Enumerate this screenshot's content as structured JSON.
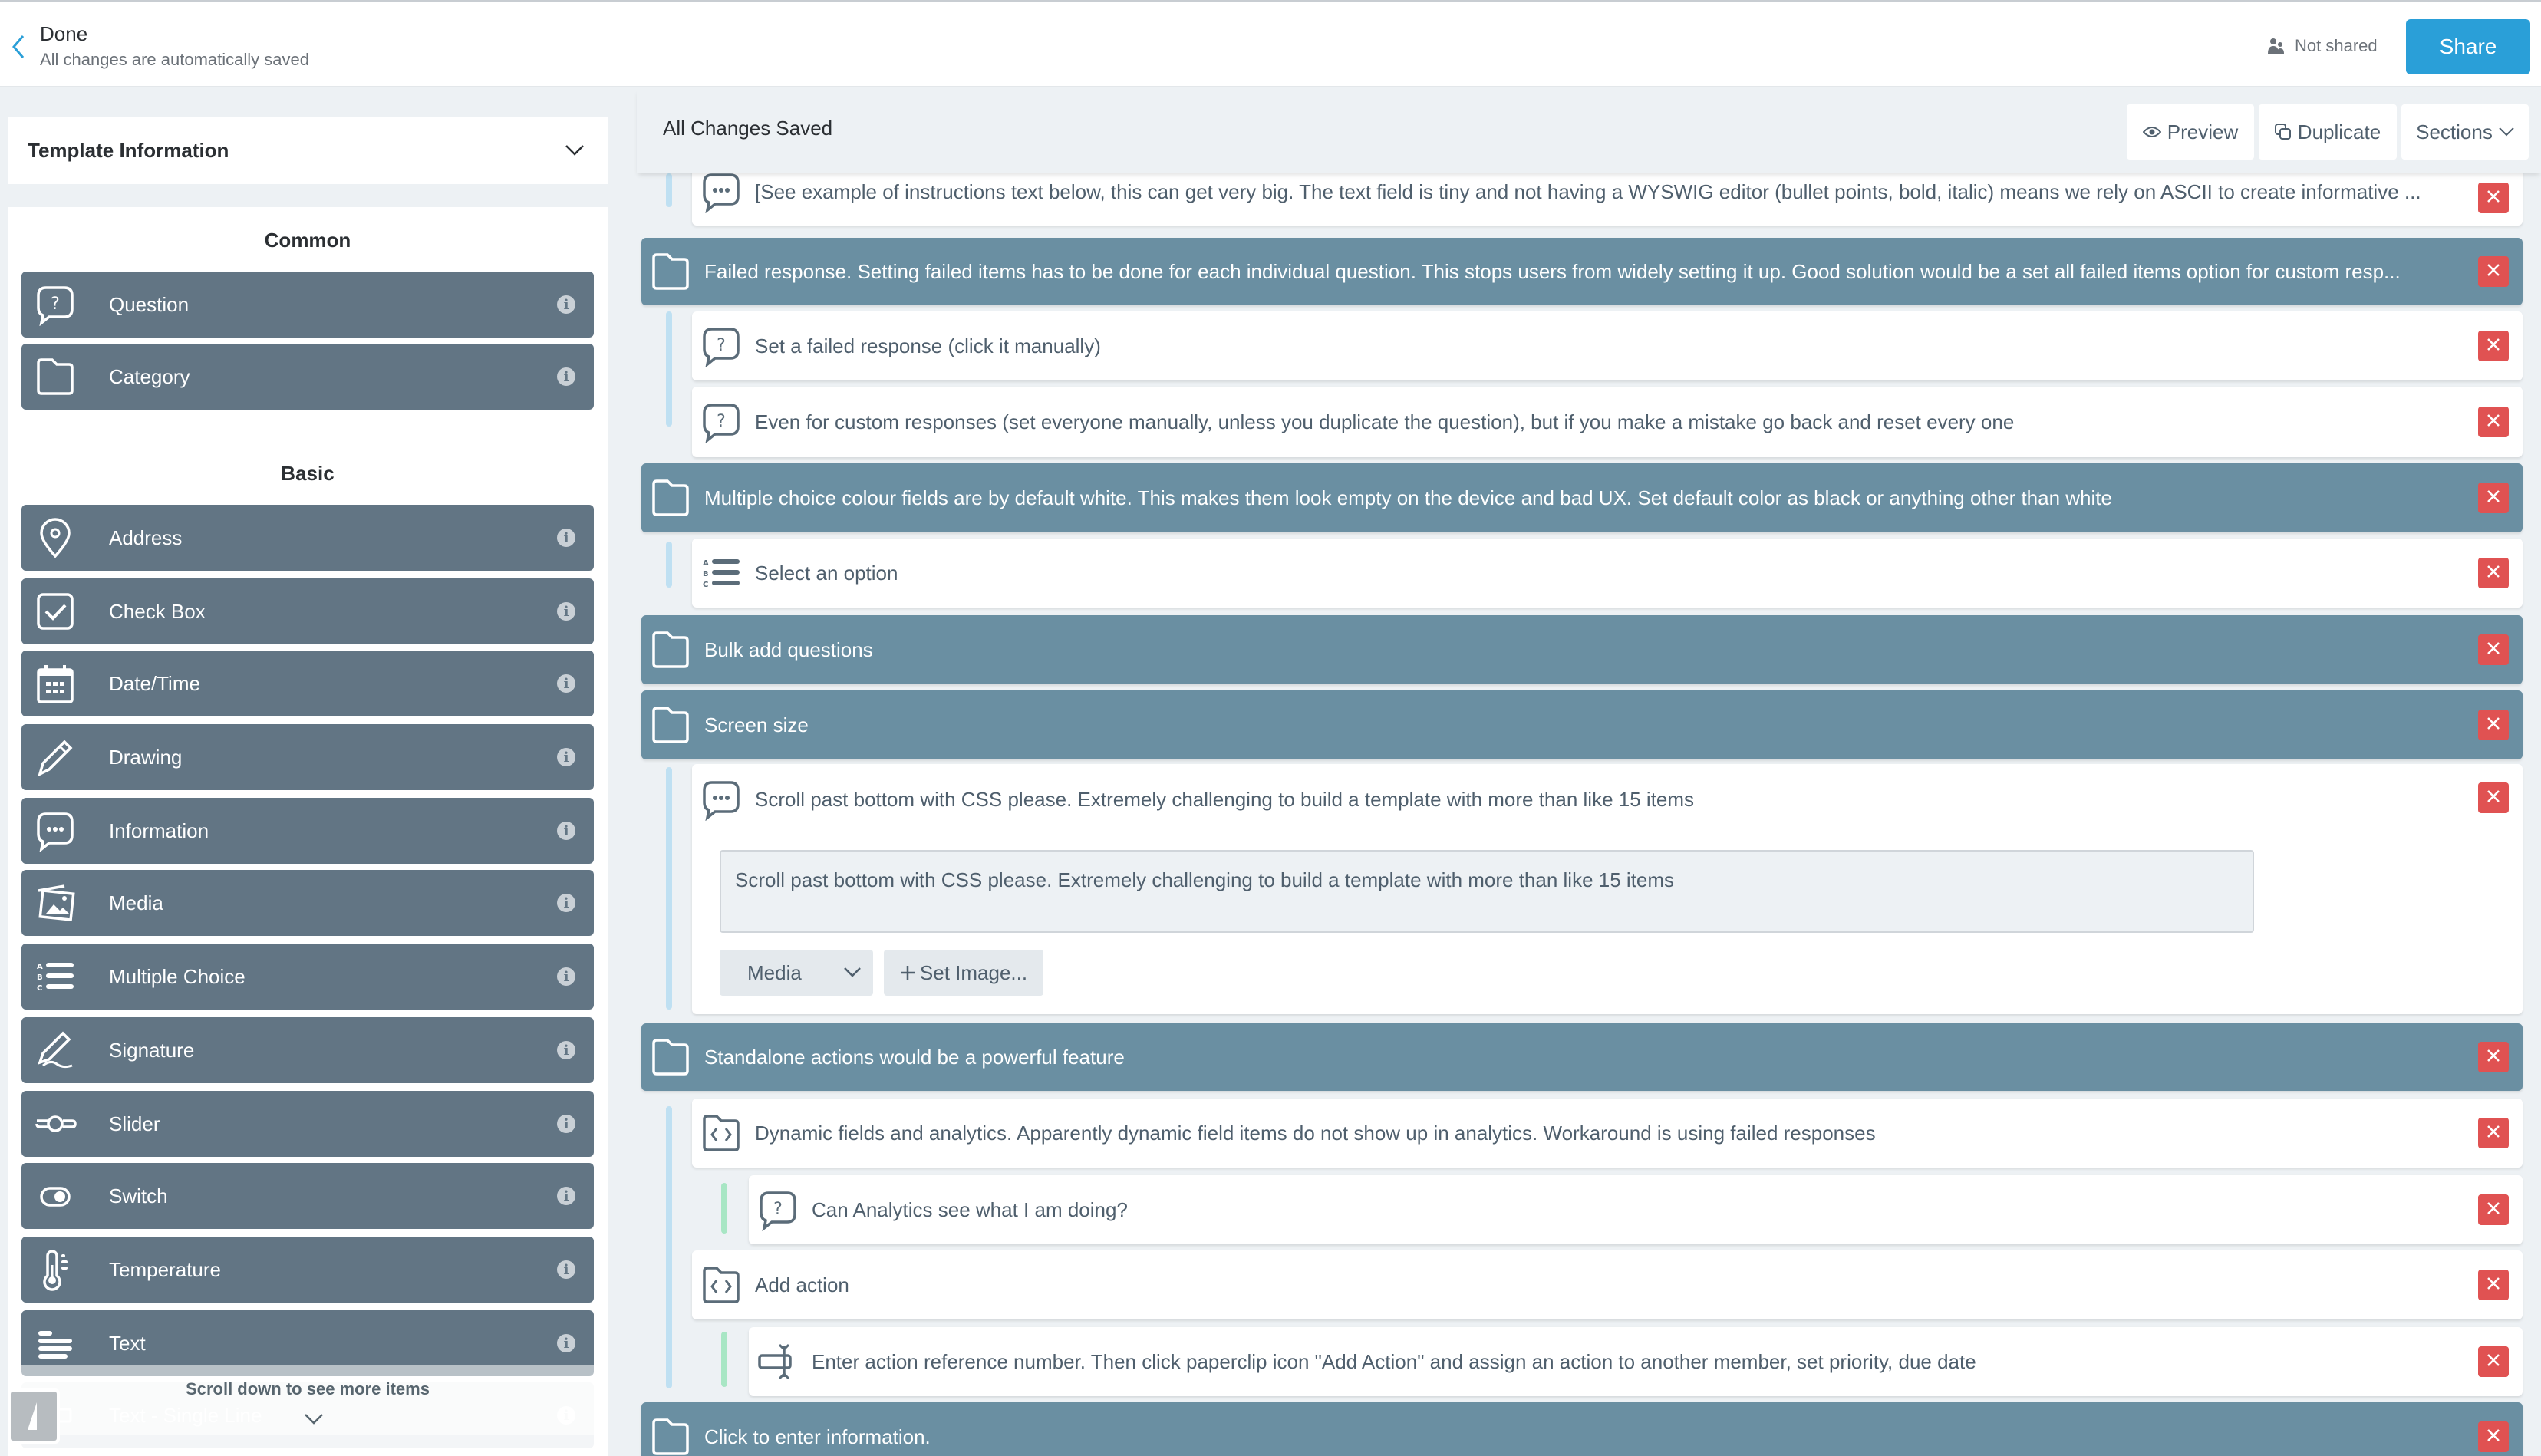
{
  "topbar": {
    "done_title": "Done",
    "done_subtitle": "All changes are automatically saved",
    "sharing_status": "Not shared",
    "share_label": "Share"
  },
  "sidebar": {
    "template_info_label": "Template Information",
    "groups": [
      {
        "title": "Common"
      },
      {
        "title": "Basic"
      }
    ],
    "items": [
      {
        "label": "Question",
        "icon": "question-bubble-icon"
      },
      {
        "label": "Category",
        "icon": "folder-icon"
      },
      {
        "label": "Address",
        "icon": "location-pin-icon"
      },
      {
        "label": "Check Box",
        "icon": "checkbox-icon"
      },
      {
        "label": "Date/Time",
        "icon": "calendar-icon"
      },
      {
        "label": "Drawing",
        "icon": "pencil-icon"
      },
      {
        "label": "Information",
        "icon": "info-bubble-icon"
      },
      {
        "label": "Media",
        "icon": "image-icon"
      },
      {
        "label": "Multiple Choice",
        "icon": "abc-list-icon"
      },
      {
        "label": "Signature",
        "icon": "signature-icon"
      },
      {
        "label": "Slider",
        "icon": "slider-icon"
      },
      {
        "label": "Switch",
        "icon": "switch-icon"
      },
      {
        "label": "Temperature",
        "icon": "thermometer-icon"
      },
      {
        "label": "Text",
        "icon": "text-lines-icon"
      },
      {
        "label": "Text - Single Line",
        "icon": "text-single-line-icon"
      }
    ],
    "info_glyph": "i",
    "scroll_hint": "Scroll down to see more items"
  },
  "main": {
    "saved_status": "All Changes Saved",
    "preview_label": "Preview",
    "duplicate_label": "Duplicate",
    "sections_label": "Sections",
    "rows": [
      {
        "type": "item",
        "icon": "info-bubble-icon",
        "text": "[See example of instructions text below, this can get very big. The text field is tiny and not having a WYSWIG editor (bullet points, bold, italic) means we rely on ASCII to create informative ..."
      },
      {
        "type": "category",
        "icon": "folder-icon",
        "text": "Failed response. Setting failed items has to be done for each individual question. This stops users from widely setting it up. Good solution would be a set all failed items option for custom resp..."
      },
      {
        "type": "item",
        "icon": "question-bubble-icon",
        "text": "Set a failed response (click it manually)"
      },
      {
        "type": "item",
        "icon": "question-bubble-icon",
        "text": "Even for custom responses (set everyone manually, unless you duplicate the question), but if you make a mistake go back and reset every one"
      },
      {
        "type": "category",
        "icon": "folder-icon",
        "text": "Multiple choice colour fields are by default white. This makes them look empty on the device and bad UX. Set default color as black or anything other than white"
      },
      {
        "type": "item",
        "icon": "abc-list-icon",
        "text": "Select an option"
      },
      {
        "type": "category",
        "icon": "folder-icon",
        "text": "Bulk add questions"
      },
      {
        "type": "category",
        "icon": "folder-icon",
        "text": "Screen size"
      },
      {
        "type": "expanded",
        "icon": "info-bubble-icon",
        "text": "Scroll past bottom with CSS please. Extremely challenging to build a template with more than like 15 items",
        "textarea_value": "Scroll past bottom with CSS please. Extremely challenging to build a template with more than like 15 items",
        "media_select": "Media",
        "set_image_label": "Set Image..."
      },
      {
        "type": "category",
        "icon": "folder-icon",
        "text": "Standalone actions would be a powerful feature"
      },
      {
        "type": "item",
        "icon": "dynamic-field-icon",
        "text": "Dynamic fields and analytics. Apparently dynamic field items do not show up in analytics. Workaround is using failed responses"
      },
      {
        "type": "item",
        "icon": "question-bubble-icon",
        "text": "Can Analytics see what I am doing?"
      },
      {
        "type": "item",
        "icon": "dynamic-field-icon",
        "text": "Add action"
      },
      {
        "type": "item",
        "icon": "action-icon",
        "text": "Enter action reference number. Then click paperclip icon \"Add Action\" and assign an action to another member, set priority, due date"
      },
      {
        "type": "category",
        "icon": "folder-icon",
        "text": "Click to enter information."
      }
    ]
  },
  "colors": {
    "accent": "#2a9fd8",
    "category_row": "#6a8fa2",
    "palette_item": "#627584",
    "delete": "#e05252",
    "rail_blue": "#bfe0f2",
    "rail_green": "#a8e6c4"
  }
}
